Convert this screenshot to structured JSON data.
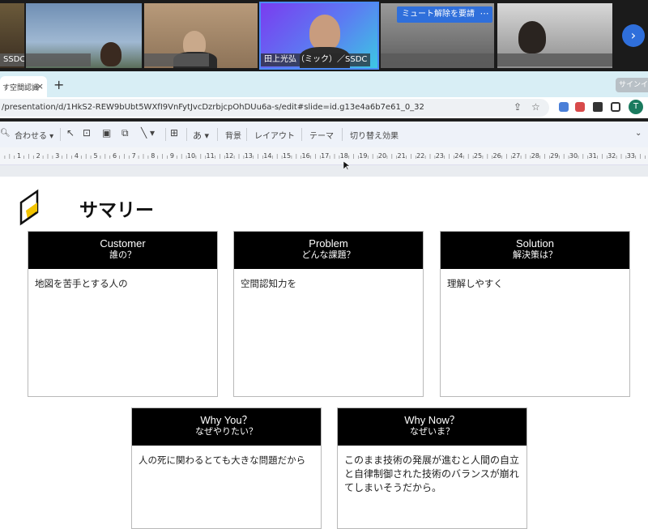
{
  "meeting": {
    "participants": [
      {
        "name": "SSDC"
      },
      {
        "name": ""
      },
      {
        "name": ""
      },
      {
        "name": "田上光弘（ミック）／SSDC"
      },
      {
        "name": ""
      },
      {
        "name": ""
      }
    ],
    "unmute_request_label": "ミュート解除を要請",
    "more_label": "⋯",
    "next_label": "›"
  },
  "browser": {
    "tab_title": "す空間認識",
    "tab_close": "×",
    "new_tab": "+",
    "signin_label": "サインイン",
    "url": "/presentation/d/1HkS2-REW9bUbt5WXfI9VnFytJvcDzrbjcpOhDUu6a-s/edit#slide=id.g13e4a6b7e61_0_32",
    "avatar_letter": "T"
  },
  "toolbar": {
    "zoom_label": "合わせる",
    "background_label": "背景",
    "layout_label": "レイアウト",
    "theme_label": "テーマ",
    "transition_label": "切り替え効果",
    "text_style_label": "あ"
  },
  "ruler": {
    "ticks": [
      "1",
      "2",
      "3",
      "4",
      "5",
      "6",
      "7",
      "8",
      "9",
      "10",
      "11",
      "12",
      "13",
      "14",
      "15",
      "16",
      "17",
      "18",
      "19",
      "20",
      "21",
      "22",
      "23",
      "24",
      "25",
      "26",
      "27",
      "28",
      "29",
      "30",
      "31",
      "32",
      "33"
    ]
  },
  "slide": {
    "title": "サマリー",
    "cards": [
      {
        "title": "Customer",
        "subtitle": "誰の？",
        "body": "地図を苦手とする人の"
      },
      {
        "title": "Problem",
        "subtitle": "どんな課題？",
        "body": "空間認知力を"
      },
      {
        "title": "Solution",
        "subtitle": "解決策は？",
        "body": "理解しやすく"
      },
      {
        "title": "Why You？",
        "subtitle": "なぜやりたい？",
        "body": "人の死に関わるとても大きな問題だから"
      },
      {
        "title": "Why Now？",
        "subtitle": "なぜいま？",
        "body": "このまま技術の発展が進むと人間の自立と自律制御された技術のバランスが崩れてしまいそうだから。"
      }
    ]
  },
  "colors": {
    "accent": "#2f6fdb",
    "card_header": "#000000",
    "logo_yellow": "#f2c300",
    "tabbar": "#d8eef5"
  }
}
